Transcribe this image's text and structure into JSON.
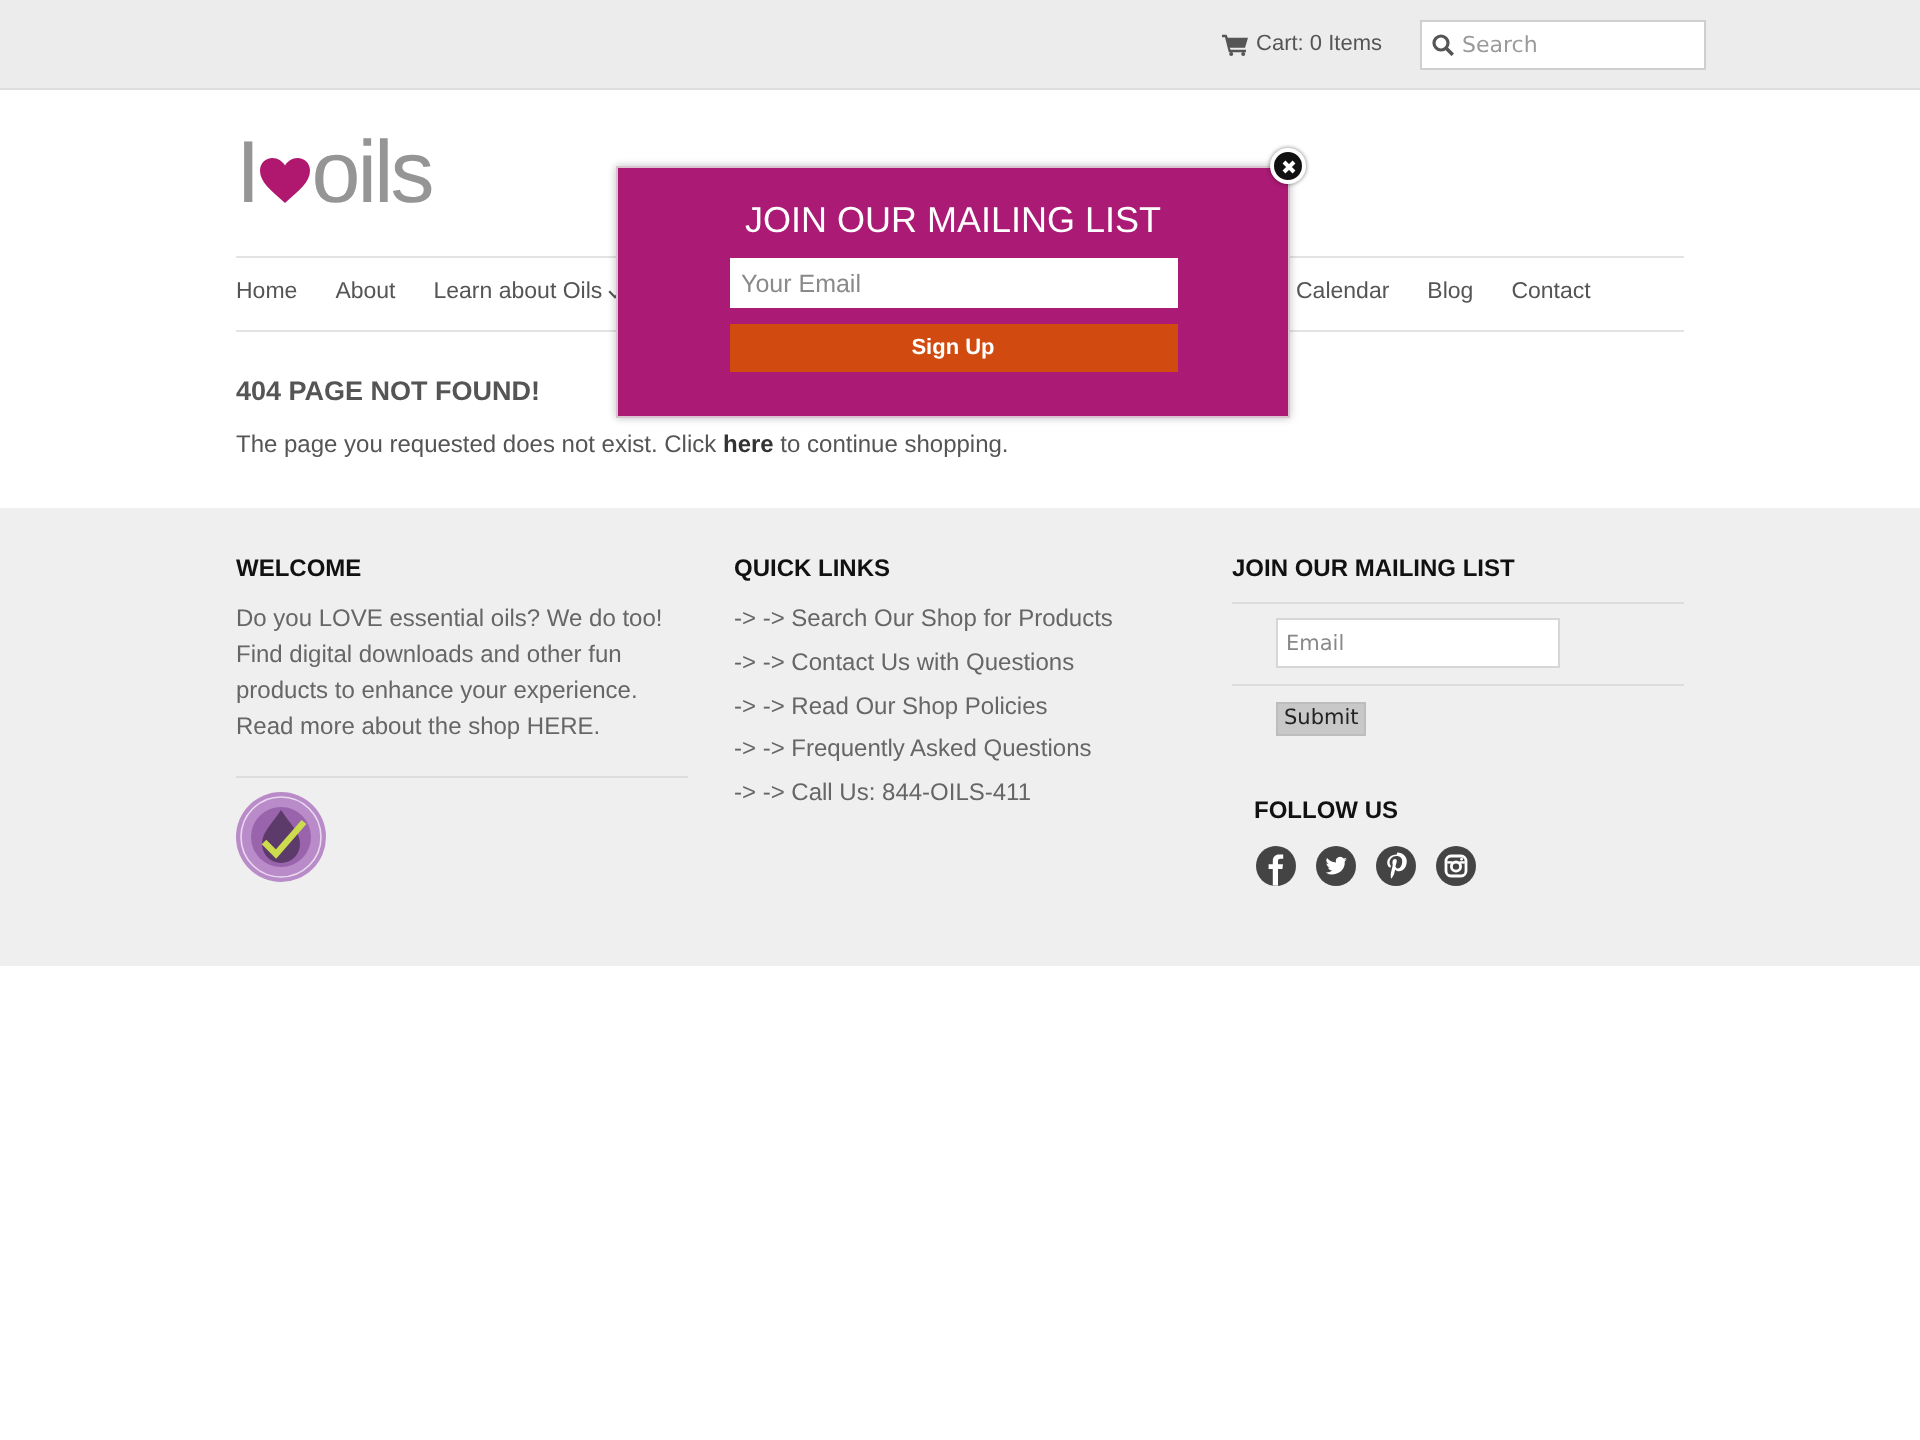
{
  "top_bar": {
    "cart_label": "Cart: 0 Items",
    "search": {
      "placeholder": "Search"
    }
  },
  "logo": {
    "text_before": "I",
    "text_after": "oils"
  },
  "nav": {
    "items_left": [
      {
        "label": "Home",
        "has_dropdown": false
      },
      {
        "label": "About",
        "has_dropdown": false
      },
      {
        "label": "Learn about Oils",
        "has_dropdown": true
      }
    ],
    "items_right": [
      {
        "label": "Calendar",
        "has_dropdown": false
      },
      {
        "label": "Blog",
        "has_dropdown": false
      },
      {
        "label": "Contact",
        "has_dropdown": false
      }
    ]
  },
  "content": {
    "title": "404 PAGE NOT FOUND!",
    "message": {
      "before": "The page you requested does not exist. Click ",
      "link": "here",
      "after": " to continue shopping."
    }
  },
  "footer": {
    "welcome": {
      "title": "WELCOME",
      "text": "Do you LOVE essential oils? We do too! Find digital downloads and other fun products to enhance your experience. Read more about the shop HERE."
    },
    "quick_links": {
      "title": "QUICK LINKS",
      "links": [
        "-> -> Search Our Shop for Products",
        "-> -> Contact Us with Questions",
        "-> -> Read Our Shop Policies",
        "-> -> Frequently Asked Questions",
        "-> -> Call Us: 844-OILS-411"
      ]
    },
    "mailing_list": {
      "title": "JOIN OUR MAILING LIST",
      "email": {
        "placeholder": "Email"
      },
      "submit": "Submit"
    },
    "follow": {
      "title": "FOLLOW US"
    }
  },
  "popup": {
    "title": "JOIN OUR MAILING LIST",
    "email": {
      "placeholder": "Your Email"
    },
    "button": "Sign Up"
  }
}
